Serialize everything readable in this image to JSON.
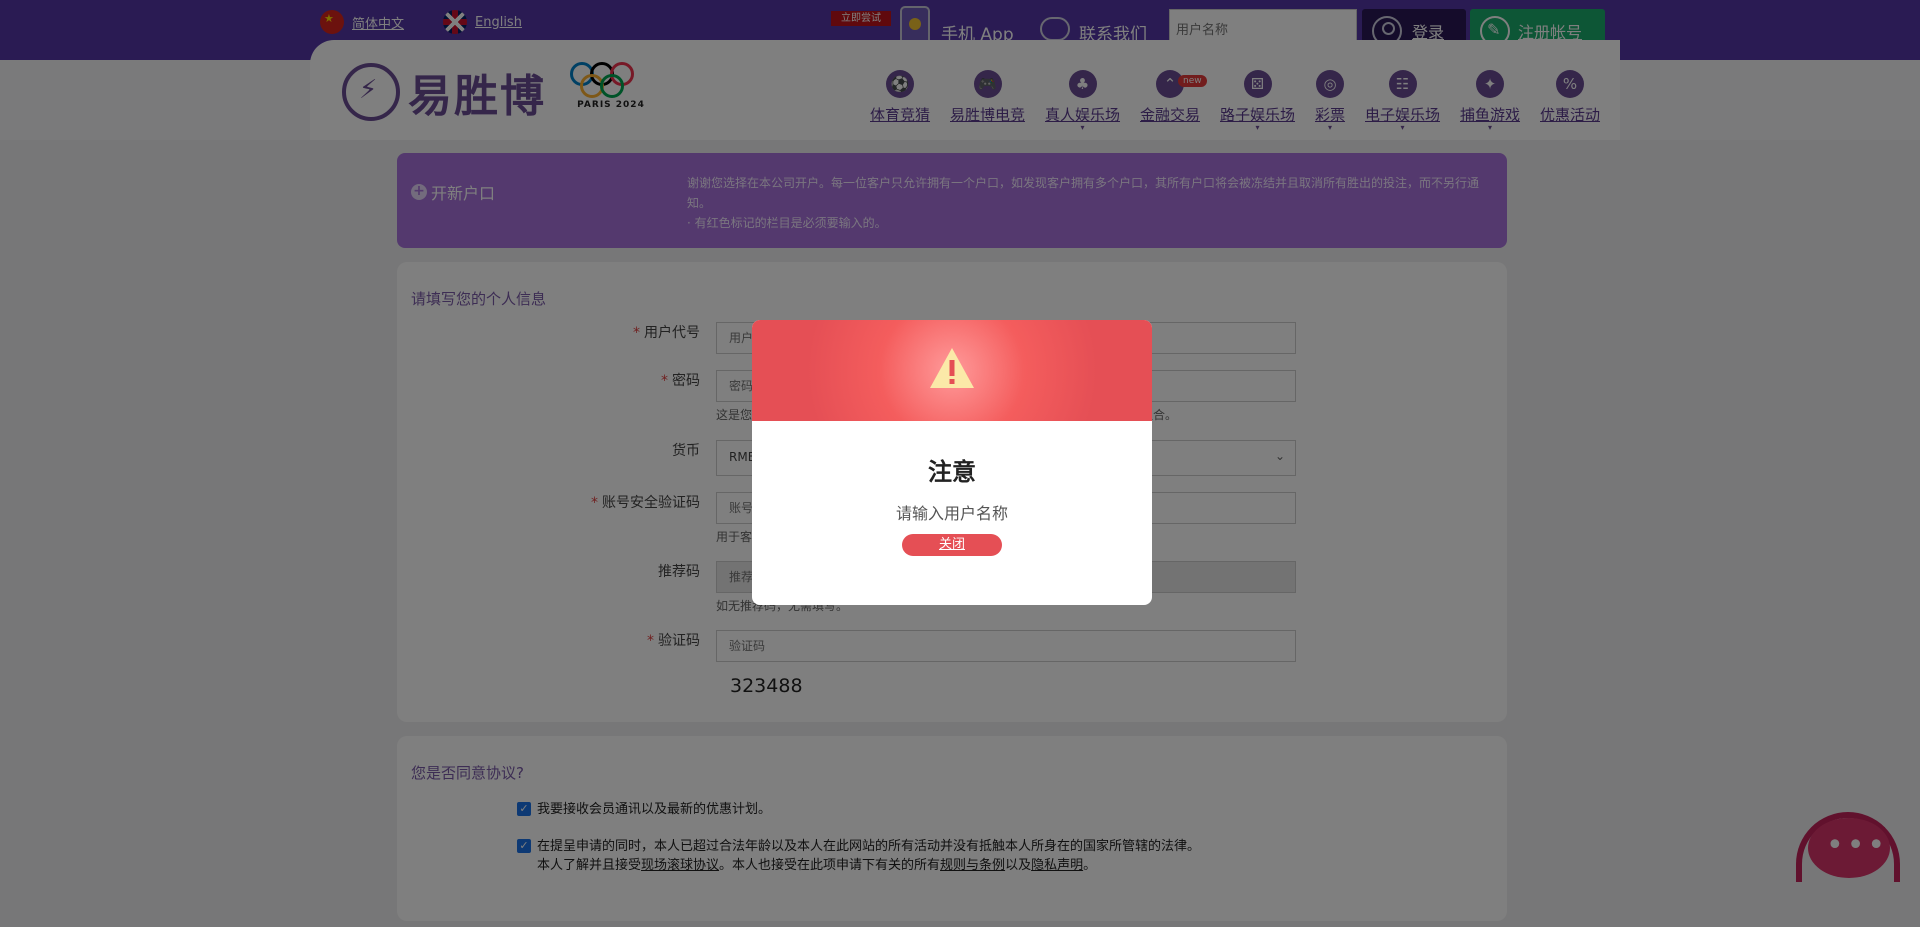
{
  "topbar": {
    "lang_zh": "简体中文",
    "lang_en": "English",
    "trial_badge": "立即尝试",
    "mobile_app": "手机 App",
    "contact_us": "联系我们",
    "username_placeholder": "用户名称",
    "login": "登录",
    "register": "注册帐号"
  },
  "logo": {
    "brand": "易胜博",
    "olympic_label": "PARIS 2024"
  },
  "nav": [
    {
      "label": "体育竞猜",
      "icon": "soccer-ball-icon",
      "glyph": "⚽"
    },
    {
      "label": "易胜博电竞",
      "icon": "gamepad-icon",
      "glyph": "🎮"
    },
    {
      "label": "真人娱乐场",
      "icon": "card-suits-icon",
      "glyph": "♣"
    },
    {
      "label": "金融交易",
      "icon": "trend-icon",
      "glyph": "⌃",
      "badge": "new"
    },
    {
      "label": "路子娱乐场",
      "icon": "dice-icon",
      "glyph": "⚄"
    },
    {
      "label": "彩票",
      "icon": "lottery-balls-icon",
      "glyph": "◎"
    },
    {
      "label": "电子娱乐场",
      "icon": "slot-machine-icon",
      "glyph": "☷"
    },
    {
      "label": "捕鱼游戏",
      "icon": "fish-icon",
      "glyph": "✦"
    },
    {
      "label": "优惠活动",
      "icon": "percent-icon",
      "glyph": "%"
    }
  ],
  "banner": {
    "title": "开新户口",
    "line1": "谢谢您选择在本公司开户。每一位客户只允许拥有一个户口，如发现客户拥有多个户口，其所有户口将会被冻结并且取消所有胜出的投注，而不另行通知。",
    "line2": "· 有红色标记的栏目是必须要输入的。"
  },
  "form": {
    "title": "请填写您的个人信息",
    "username_label": "用户代号",
    "username_placeholder": "用户",
    "password_label": "密码",
    "password_placeholder": "密码",
    "password_hint_start": "这是您",
    "password_hint_end": "的组合。",
    "currency_label": "货币",
    "currency_value": "RMB",
    "security_label": "账号安全验证码",
    "security_placeholder": "账号",
    "security_hint": "用于客",
    "referral_label": "推荐码",
    "referral_placeholder": "推荐",
    "referral_hint": "如无推荐码，无需填写。",
    "captcha_label": "验证码",
    "captcha_placeholder": "验证码",
    "captcha_value": "323488"
  },
  "agreement": {
    "title": "您是否同意协议?",
    "check1": "我要接收会员通讯以及最新的优惠计划。",
    "check2_line1": "在提呈申请的同时，本人已超过合法年龄以及本人在此网站的所有活动并没有抵触本人所身在的国家所管辖的法律。",
    "check2_a": "本人了解并且接受",
    "link_ball": "现场滚球协议",
    "check2_b": "。本人也接受在此项申请下有关的所有",
    "link_rules": "规则与条例",
    "check2_c": "以及",
    "link_privacy": "隐私声明",
    "check2_d": "。"
  },
  "modal": {
    "title": "注意",
    "message": "请输入用户名称",
    "close": "关闭"
  }
}
